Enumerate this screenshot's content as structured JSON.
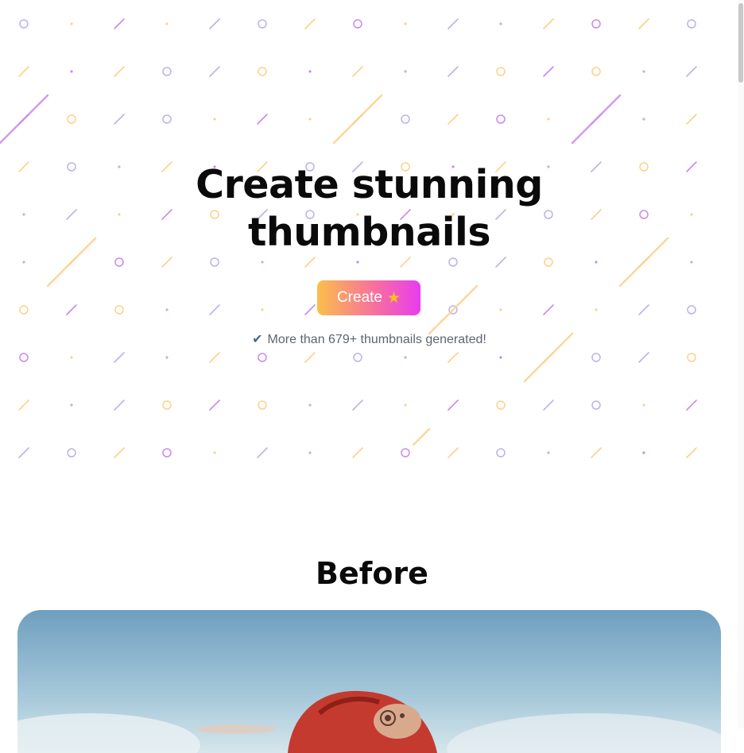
{
  "hero": {
    "title_line1": "Create stunning",
    "title_line2": "thumbnails",
    "cta_label": "Create",
    "cta_icon": "glowing-star-icon",
    "stat_icon": "check-mark-icon",
    "stat_text": "More than 679+ thumbnails generated!"
  },
  "before": {
    "title": "Before"
  },
  "colors": {
    "pattern_purple": "#c98aef",
    "pattern_orange": "#fcd18a",
    "pattern_lavender": "#b9b4ea",
    "cta_gradient_start": "#fbbf4a",
    "cta_gradient_end": "#e83cf0"
  }
}
